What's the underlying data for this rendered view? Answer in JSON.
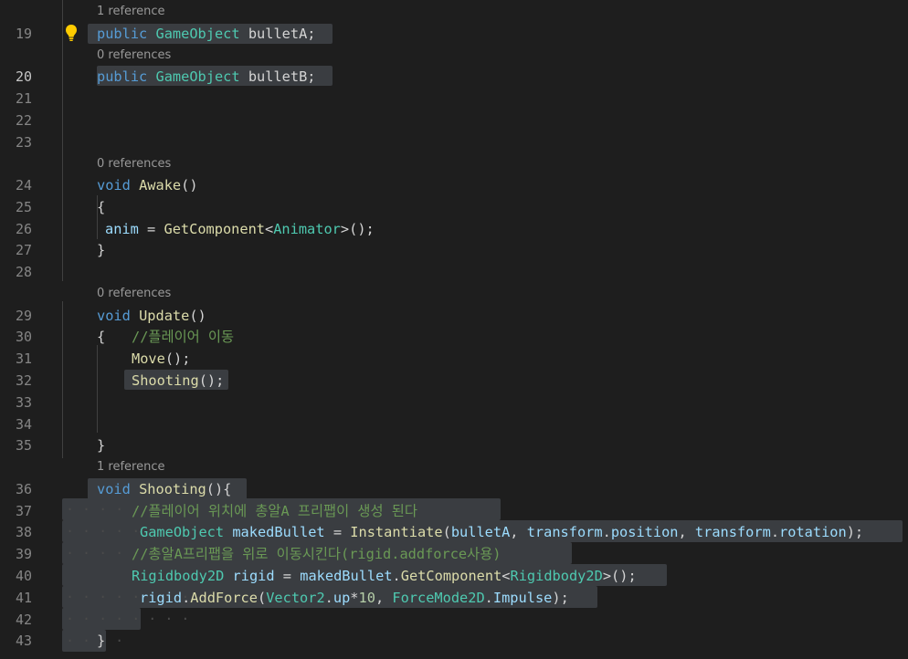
{
  "lens": {
    "l19": "1 reference",
    "l20": "0 references",
    "l24": "0 references",
    "l29": "0 references",
    "l36": "1 reference"
  },
  "line_numbers": [
    "19",
    "20",
    "21",
    "22",
    "23",
    "24",
    "25",
    "26",
    "27",
    "28",
    "29",
    "30",
    "31",
    "32",
    "33",
    "34",
    "35",
    "36",
    "37",
    "38",
    "39",
    "40",
    "41",
    "42",
    "43"
  ],
  "code": {
    "l19": {
      "kw": "public",
      "type": "GameObject",
      "name": "bulletA",
      "end": ";"
    },
    "l20": {
      "kw": "public",
      "type": "GameObject",
      "name": "bulletB",
      "end": ";"
    },
    "l24": {
      "kw": "void",
      "fn": "Awake",
      "end": "()"
    },
    "l25": {
      "text": "{"
    },
    "l26": {
      "var": "anim",
      "eq": " = ",
      "fn": "GetComponent",
      "lt": "<",
      "type": "Animator",
      "end": ">();"
    },
    "l27": {
      "text": "}"
    },
    "l29": {
      "kw": "void",
      "fn": "Update",
      "end": "()"
    },
    "l30": {
      "brace": "{",
      "comment": "//플레이어 이동"
    },
    "l31": {
      "fn": "Move",
      "end": "();"
    },
    "l32": {
      "fn": "Shooting",
      "end": "();"
    },
    "l35": {
      "text": "}"
    },
    "l36": {
      "kw": "void",
      "fn": "Shooting",
      "end": "(){"
    },
    "l37": {
      "comment": "//플레이어 위치에 총알A 프리팹이 생성 된다"
    },
    "l38": {
      "type": "GameObject",
      "var": "makedBullet",
      "eq": " = ",
      "fn": "Instantiate",
      "open": "(",
      "a1": "bulletA",
      "c1": ", ",
      "a2": "transform",
      "d1": ".",
      "a3": "position",
      "c2": ", ",
      "a4": "transform",
      "d2": ".",
      "a5": "rotation",
      "end": ");"
    },
    "l39": {
      "comment": "//총알A프리팹을 위로 이동시킨다(rigid.addforce사용)"
    },
    "l40": {
      "type": "Rigidbody2D",
      "var": "rigid",
      "eq": " = ",
      "obj": "makedBullet",
      "dot": ".",
      "fn": "GetComponent",
      "lt": "<",
      "type2": "Rigidbody2D",
      "end": ">();"
    },
    "l41": {
      "obj": "rigid",
      "dot": ".",
      "fn": "AddForce",
      "open": "(",
      "type": "Vector2",
      "d1": ".",
      "m1": "up",
      "op": "*",
      "num": "10",
      "c1": ", ",
      "type2": "ForceMode2D",
      "d2": ".",
      "m2": "Impulse",
      "end": ");"
    },
    "l43": {
      "text": "}"
    }
  },
  "colors": {
    "background": "#1e1e1e",
    "keyword": "#569cd6",
    "type": "#4ec9b0",
    "function": "#dcdcaa",
    "variable": "#9cdcfe",
    "comment": "#6a9955",
    "number": "#b5cea8",
    "selection": "#3a3d41",
    "lightbulb": "#ffcc00"
  },
  "icons": {
    "lightbulb": "lightbulb-icon"
  }
}
